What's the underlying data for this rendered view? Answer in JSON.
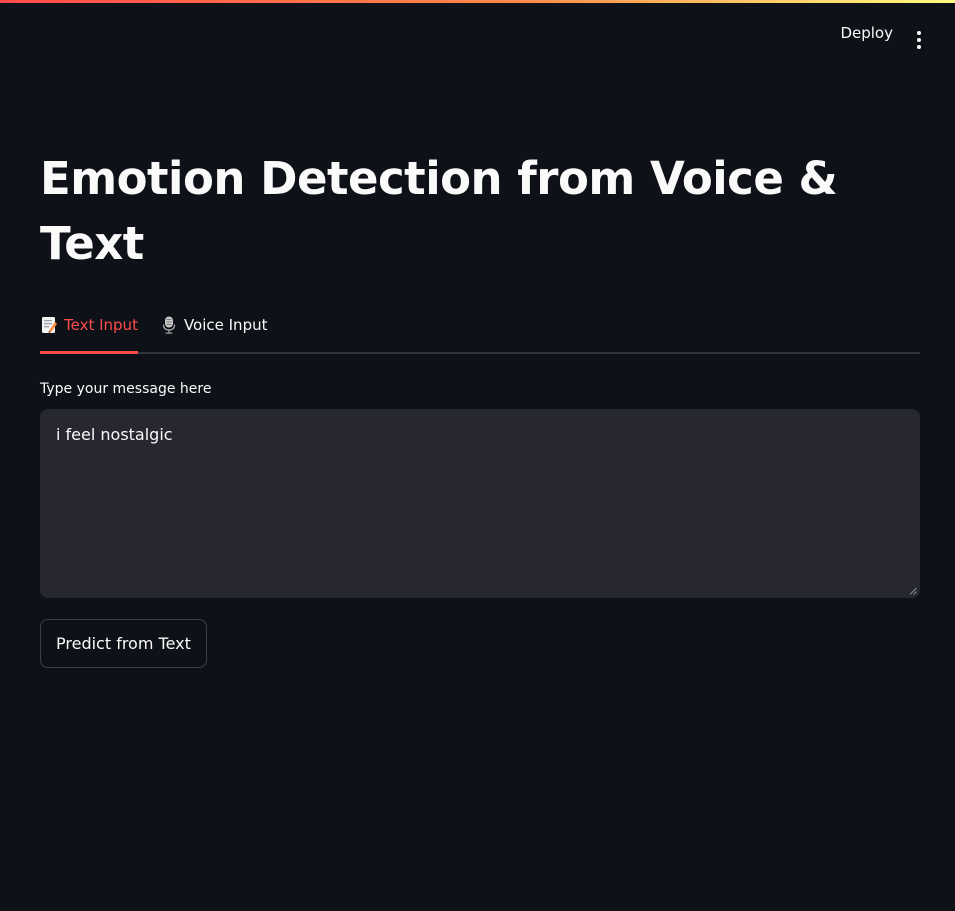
{
  "colors": {
    "background": "#0e1117",
    "accent": "#ff4b4b",
    "input_background": "#262730",
    "text": "#fafafa"
  },
  "header": {
    "deploy_label": "Deploy",
    "menu_icon": "more-vertical-icon"
  },
  "main": {
    "title": "Emotion Detection from Voice & Text",
    "tabs": [
      {
        "label": "Text Input",
        "icon": "memo-icon",
        "active": true
      },
      {
        "label": "Voice Input",
        "icon": "microphone-icon",
        "active": false
      }
    ],
    "text_input": {
      "label": "Type your message here",
      "value": "i feel nostalgic"
    },
    "predict_button_label": "Predict from Text"
  }
}
